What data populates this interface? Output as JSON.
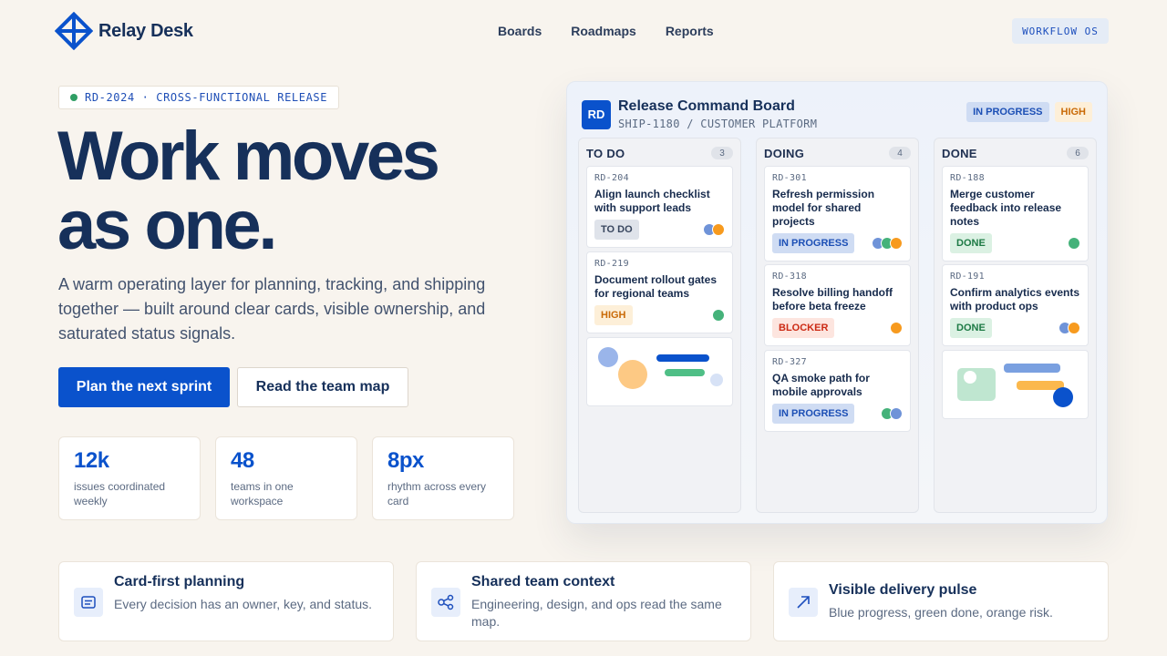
{
  "header": {
    "brand": "Relay Desk",
    "nav": [
      "Boards",
      "Roadmaps",
      "Reports"
    ],
    "badge": "WORKFLOW OS"
  },
  "hero": {
    "eyebrow": "RD-2024 · CROSS-FUNCTIONAL RELEASE",
    "title_line1": "Work moves",
    "title_line2": "as one.",
    "copy": "A warm operating layer for planning, tracking, and shipping together — built around clear cards, visible ownership, and saturated status signals.",
    "primary_cta": "Plan the next sprint",
    "secondary_cta": "Read the team map"
  },
  "stats": [
    {
      "value": "12k",
      "label": "issues coordinated weekly"
    },
    {
      "value": "48",
      "label": "teams in one workspace"
    },
    {
      "value": "8px",
      "label": "rhythm across every card"
    }
  ],
  "board": {
    "avatar": "RD",
    "title": "Release Command Board",
    "subtitle": "SHIP-1180 / CUSTOMER PLATFORM",
    "tags": [
      "IN PROGRESS",
      "HIGH"
    ],
    "columns": [
      {
        "name": "TO DO",
        "count": "3",
        "cards": [
          {
            "key": "RD-204",
            "title": "Align launch checklist with support leads",
            "status": "TO DO"
          },
          {
            "key": "RD-219",
            "title": "Document rollout gates for regional teams",
            "status": "HIGH"
          }
        ]
      },
      {
        "name": "DOING",
        "count": "4",
        "cards": [
          {
            "key": "RD-301",
            "title": "Refresh permission model for shared projects",
            "status": "IN PROGRESS"
          },
          {
            "key": "RD-318",
            "title": "Resolve billing handoff before beta freeze",
            "status": "BLOCKER"
          },
          {
            "key": "RD-327",
            "title": "QA smoke path for mobile approvals",
            "status": "IN PROGRESS"
          }
        ]
      },
      {
        "name": "DONE",
        "count": "6",
        "cards": [
          {
            "key": "RD-188",
            "title": "Merge customer feedback into release notes",
            "status": "DONE"
          },
          {
            "key": "RD-191",
            "title": "Confirm analytics events with product ops",
            "status": "DONE"
          }
        ]
      }
    ]
  },
  "features": [
    {
      "icon": "document-icon",
      "title": "Card-first planning",
      "desc": "Every decision has an owner, key, and status."
    },
    {
      "icon": "share-icon",
      "title": "Shared team context",
      "desc": "Engineering, design, and ops read the same map."
    },
    {
      "icon": "arrow-up-right-icon",
      "title": "Visible delivery pulse",
      "desc": "Blue progress, green done, orange risk."
    }
  ],
  "colors": {
    "primary": "#0a52cc",
    "navy": "#16305a",
    "background": "#f8f4ee",
    "status_blue": "#cfdcf3",
    "status_orange": "#fdefd8",
    "status_red": "#fde5df",
    "status_green": "#dbf1e3"
  }
}
